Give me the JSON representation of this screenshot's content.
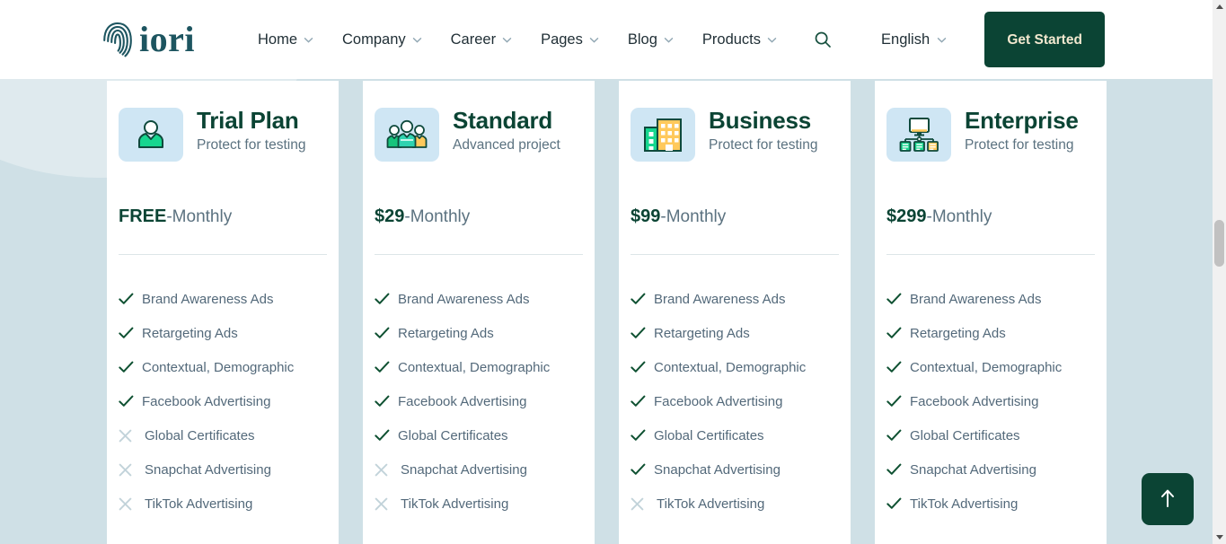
{
  "header": {
    "logo_text": "iori",
    "logo_icon": "fingerprint-icon",
    "nav_items": [
      {
        "label": "Home",
        "icon": "chevron-down-icon"
      },
      {
        "label": "Company",
        "icon": "chevron-down-icon"
      },
      {
        "label": "Career",
        "icon": "chevron-down-icon"
      },
      {
        "label": "Pages",
        "icon": "chevron-down-icon"
      },
      {
        "label": "Blog",
        "icon": "chevron-down-icon"
      },
      {
        "label": "Products",
        "icon": "chevron-down-icon"
      }
    ],
    "search_icon": "search-icon",
    "language": {
      "label": "English",
      "icon": "chevron-down-icon"
    },
    "cta_label": "Get Started"
  },
  "colors": {
    "brand_dark_green": "#0b4434",
    "brand_teal": "#1d5560",
    "cta_text": "#f2e8cf",
    "page_background": "#cfe0e6",
    "card_background": "#ffffff",
    "icon_tile": "#cfe6f4",
    "check_green": "#0f5132",
    "cross_gray": "#c2d3da",
    "feature_text": "#53697a"
  },
  "pricing": {
    "price_suffix": "-Monthly",
    "plans": [
      {
        "name": "Trial Plan",
        "subtitle": "Protect for testing",
        "icon": "single-person-icon",
        "price": "FREE",
        "period": "-Monthly",
        "features": [
          {
            "label": "Brand Awareness Ads",
            "included": true
          },
          {
            "label": "Retargeting Ads",
            "included": true
          },
          {
            "label": "Contextual, Demographic",
            "included": true
          },
          {
            "label": "Facebook Advertising",
            "included": true
          },
          {
            "label": "Global Certificates",
            "included": false
          },
          {
            "label": "Snapchat Advertising",
            "included": false
          },
          {
            "label": "TikTok Advertising",
            "included": false
          }
        ]
      },
      {
        "name": "Standard",
        "subtitle": "Advanced project",
        "icon": "group-people-icon",
        "price": "$29",
        "period": "-Monthly",
        "features": [
          {
            "label": "Brand Awareness Ads",
            "included": true
          },
          {
            "label": "Retargeting Ads",
            "included": true
          },
          {
            "label": "Contextual, Demographic",
            "included": true
          },
          {
            "label": "Facebook Advertising",
            "included": true
          },
          {
            "label": "Global Certificates",
            "included": true
          },
          {
            "label": "Snapchat Advertising",
            "included": false
          },
          {
            "label": "TikTok Advertising",
            "included": false
          }
        ]
      },
      {
        "name": "Business",
        "subtitle": "Protect for testing",
        "icon": "office-buildings-icon",
        "price": "$99",
        "period": "-Monthly",
        "features": [
          {
            "label": "Brand Awareness Ads",
            "included": true
          },
          {
            "label": "Retargeting Ads",
            "included": true
          },
          {
            "label": "Contextual, Demographic",
            "included": true
          },
          {
            "label": "Facebook Advertising",
            "included": true
          },
          {
            "label": "Global Certificates",
            "included": true
          },
          {
            "label": "Snapchat Advertising",
            "included": true
          },
          {
            "label": "TikTok Advertising",
            "included": false
          }
        ]
      },
      {
        "name": "Enterprise",
        "subtitle": "Protect for testing",
        "icon": "network-servers-icon",
        "price": "$299",
        "period": "-Monthly",
        "features": [
          {
            "label": "Brand Awareness Ads",
            "included": true
          },
          {
            "label": "Retargeting Ads",
            "included": true
          },
          {
            "label": "Contextual, Demographic",
            "included": true
          },
          {
            "label": "Facebook Advertising",
            "included": true
          },
          {
            "label": "Global Certificates",
            "included": true
          },
          {
            "label": "Snapchat Advertising",
            "included": true
          },
          {
            "label": "TikTok Advertising",
            "included": true
          }
        ]
      }
    ]
  },
  "floating": {
    "back_to_top_icon": "arrow-up-icon"
  }
}
